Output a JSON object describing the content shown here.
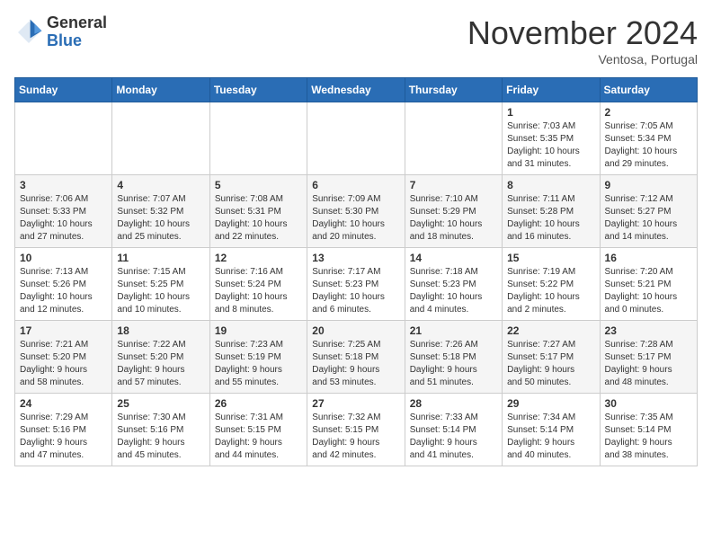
{
  "header": {
    "logo_general": "General",
    "logo_blue": "Blue",
    "month_title": "November 2024",
    "location": "Ventosa, Portugal"
  },
  "weekdays": [
    "Sunday",
    "Monday",
    "Tuesday",
    "Wednesday",
    "Thursday",
    "Friday",
    "Saturday"
  ],
  "weeks": [
    [
      {
        "day": "",
        "info": ""
      },
      {
        "day": "",
        "info": ""
      },
      {
        "day": "",
        "info": ""
      },
      {
        "day": "",
        "info": ""
      },
      {
        "day": "",
        "info": ""
      },
      {
        "day": "1",
        "info": "Sunrise: 7:03 AM\nSunset: 5:35 PM\nDaylight: 10 hours\nand 31 minutes."
      },
      {
        "day": "2",
        "info": "Sunrise: 7:05 AM\nSunset: 5:34 PM\nDaylight: 10 hours\nand 29 minutes."
      }
    ],
    [
      {
        "day": "3",
        "info": "Sunrise: 7:06 AM\nSunset: 5:33 PM\nDaylight: 10 hours\nand 27 minutes."
      },
      {
        "day": "4",
        "info": "Sunrise: 7:07 AM\nSunset: 5:32 PM\nDaylight: 10 hours\nand 25 minutes."
      },
      {
        "day": "5",
        "info": "Sunrise: 7:08 AM\nSunset: 5:31 PM\nDaylight: 10 hours\nand 22 minutes."
      },
      {
        "day": "6",
        "info": "Sunrise: 7:09 AM\nSunset: 5:30 PM\nDaylight: 10 hours\nand 20 minutes."
      },
      {
        "day": "7",
        "info": "Sunrise: 7:10 AM\nSunset: 5:29 PM\nDaylight: 10 hours\nand 18 minutes."
      },
      {
        "day": "8",
        "info": "Sunrise: 7:11 AM\nSunset: 5:28 PM\nDaylight: 10 hours\nand 16 minutes."
      },
      {
        "day": "9",
        "info": "Sunrise: 7:12 AM\nSunset: 5:27 PM\nDaylight: 10 hours\nand 14 minutes."
      }
    ],
    [
      {
        "day": "10",
        "info": "Sunrise: 7:13 AM\nSunset: 5:26 PM\nDaylight: 10 hours\nand 12 minutes."
      },
      {
        "day": "11",
        "info": "Sunrise: 7:15 AM\nSunset: 5:25 PM\nDaylight: 10 hours\nand 10 minutes."
      },
      {
        "day": "12",
        "info": "Sunrise: 7:16 AM\nSunset: 5:24 PM\nDaylight: 10 hours\nand 8 minutes."
      },
      {
        "day": "13",
        "info": "Sunrise: 7:17 AM\nSunset: 5:23 PM\nDaylight: 10 hours\nand 6 minutes."
      },
      {
        "day": "14",
        "info": "Sunrise: 7:18 AM\nSunset: 5:23 PM\nDaylight: 10 hours\nand 4 minutes."
      },
      {
        "day": "15",
        "info": "Sunrise: 7:19 AM\nSunset: 5:22 PM\nDaylight: 10 hours\nand 2 minutes."
      },
      {
        "day": "16",
        "info": "Sunrise: 7:20 AM\nSunset: 5:21 PM\nDaylight: 10 hours\nand 0 minutes."
      }
    ],
    [
      {
        "day": "17",
        "info": "Sunrise: 7:21 AM\nSunset: 5:20 PM\nDaylight: 9 hours\nand 58 minutes."
      },
      {
        "day": "18",
        "info": "Sunrise: 7:22 AM\nSunset: 5:20 PM\nDaylight: 9 hours\nand 57 minutes."
      },
      {
        "day": "19",
        "info": "Sunrise: 7:23 AM\nSunset: 5:19 PM\nDaylight: 9 hours\nand 55 minutes."
      },
      {
        "day": "20",
        "info": "Sunrise: 7:25 AM\nSunset: 5:18 PM\nDaylight: 9 hours\nand 53 minutes."
      },
      {
        "day": "21",
        "info": "Sunrise: 7:26 AM\nSunset: 5:18 PM\nDaylight: 9 hours\nand 51 minutes."
      },
      {
        "day": "22",
        "info": "Sunrise: 7:27 AM\nSunset: 5:17 PM\nDaylight: 9 hours\nand 50 minutes."
      },
      {
        "day": "23",
        "info": "Sunrise: 7:28 AM\nSunset: 5:17 PM\nDaylight: 9 hours\nand 48 minutes."
      }
    ],
    [
      {
        "day": "24",
        "info": "Sunrise: 7:29 AM\nSunset: 5:16 PM\nDaylight: 9 hours\nand 47 minutes."
      },
      {
        "day": "25",
        "info": "Sunrise: 7:30 AM\nSunset: 5:16 PM\nDaylight: 9 hours\nand 45 minutes."
      },
      {
        "day": "26",
        "info": "Sunrise: 7:31 AM\nSunset: 5:15 PM\nDaylight: 9 hours\nand 44 minutes."
      },
      {
        "day": "27",
        "info": "Sunrise: 7:32 AM\nSunset: 5:15 PM\nDaylight: 9 hours\nand 42 minutes."
      },
      {
        "day": "28",
        "info": "Sunrise: 7:33 AM\nSunset: 5:14 PM\nDaylight: 9 hours\nand 41 minutes."
      },
      {
        "day": "29",
        "info": "Sunrise: 7:34 AM\nSunset: 5:14 PM\nDaylight: 9 hours\nand 40 minutes."
      },
      {
        "day": "30",
        "info": "Sunrise: 7:35 AM\nSunset: 5:14 PM\nDaylight: 9 hours\nand 38 minutes."
      }
    ]
  ]
}
